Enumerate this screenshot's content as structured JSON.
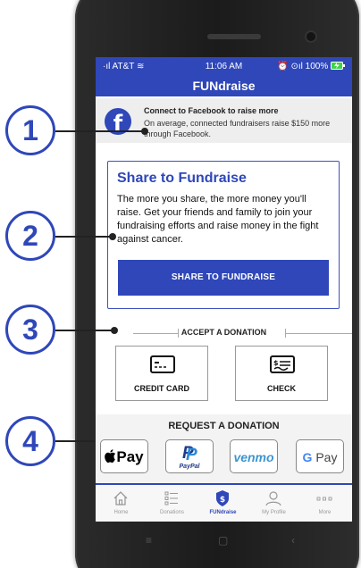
{
  "status_bar": {
    "carrier": "·ıl AT&T ≋",
    "time": "11:06 AM",
    "battery": "⏰ ⊙ıl 100%"
  },
  "app_title": "FUNdraise",
  "facebook_banner": {
    "icon_letter": "f",
    "title": "Connect to Facebook to raise more",
    "subtitle": "On average, connected fundraisers raise $150 more through Facebook."
  },
  "share": {
    "title": "Share to Fundraise",
    "body": "The more you share, the more money you'll raise. Get your friends and family to join your fundraising efforts and raise money in the fight against cancer.",
    "button_label": "SHARE TO FUNDRAISE"
  },
  "accept": {
    "label": "ACCEPT A DONATION",
    "options": [
      {
        "label": "CREDIT CARD",
        "icon": "credit-card-icon"
      },
      {
        "label": "CHECK",
        "icon": "check-icon"
      }
    ]
  },
  "request": {
    "label": "REQUEST A DONATION",
    "wallets": [
      {
        "label": "Pay",
        "icon": "apple-icon"
      },
      {
        "label": "PayPal",
        "icon": "paypal-icon"
      },
      {
        "label": "venmo",
        "icon": "venmo-logo"
      },
      {
        "label": "Pay",
        "icon": "google-g-icon"
      }
    ]
  },
  "tabs": [
    {
      "label": "Home",
      "icon": "home-icon",
      "active": false
    },
    {
      "label": "Donations",
      "icon": "list-icon",
      "active": false
    },
    {
      "label": "FUNdraise",
      "icon": "dollar-badge-icon",
      "active": true
    },
    {
      "label": "My Profile",
      "icon": "user-icon",
      "active": false
    },
    {
      "label": "More",
      "icon": "more-icon",
      "active": false
    }
  ],
  "callouts": [
    "1",
    "2",
    "3",
    "4"
  ],
  "colors": {
    "brand": "#2f47b9",
    "banner_bg": "#eeeeee",
    "venmo": "#3d95ce",
    "paypal": "#1e3a8a"
  }
}
